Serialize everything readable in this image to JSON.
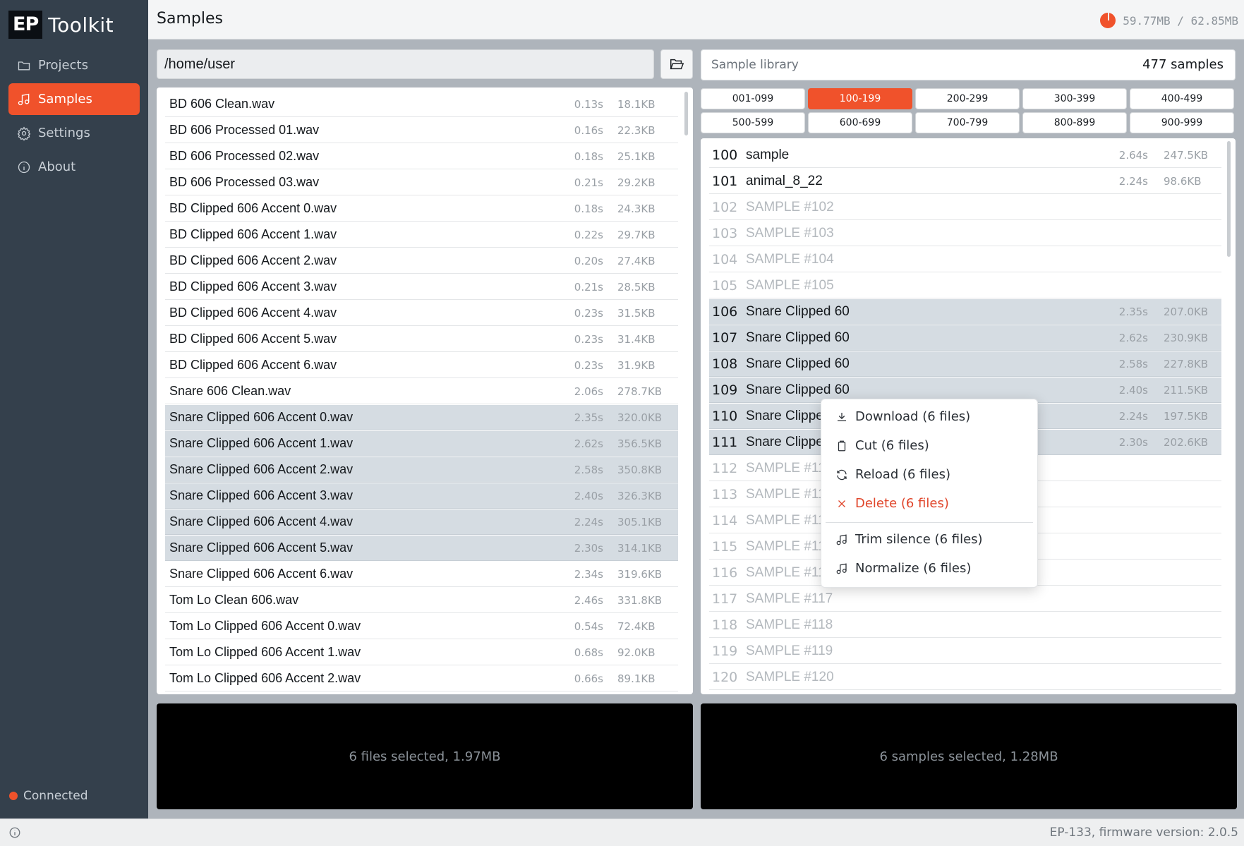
{
  "app": {
    "brand_box": "EP",
    "brand_text": "Toolkit",
    "page_title": "Samples",
    "memory": "59.77MB / 62.85MB",
    "connection_status": "Connected",
    "firmware": "EP-133, firmware version: 2.0.5",
    "accent_color": "#f0522b"
  },
  "sidebar": {
    "items": [
      {
        "label": "Projects",
        "icon": "folder-icon"
      },
      {
        "label": "Samples",
        "icon": "music-note-icon",
        "active": true
      },
      {
        "label": "Settings",
        "icon": "gear-icon"
      },
      {
        "label": "About",
        "icon": "info-icon"
      }
    ]
  },
  "browser": {
    "path": "/home/user",
    "files": [
      {
        "name": "BD 606 Clean.wav",
        "duration": "0.13s",
        "size": "18.1KB"
      },
      {
        "name": "BD 606 Processed 01.wav",
        "duration": "0.16s",
        "size": "22.3KB"
      },
      {
        "name": "BD 606 Processed 02.wav",
        "duration": "0.18s",
        "size": "25.1KB"
      },
      {
        "name": "BD 606 Processed 03.wav",
        "duration": "0.21s",
        "size": "29.2KB"
      },
      {
        "name": "BD Clipped 606 Accent 0.wav",
        "duration": "0.18s",
        "size": "24.3KB"
      },
      {
        "name": "BD Clipped 606 Accent 1.wav",
        "duration": "0.22s",
        "size": "29.7KB"
      },
      {
        "name": "BD Clipped 606 Accent 2.wav",
        "duration": "0.20s",
        "size": "27.4KB"
      },
      {
        "name": "BD Clipped 606 Accent 3.wav",
        "duration": "0.21s",
        "size": "28.5KB"
      },
      {
        "name": "BD Clipped 606 Accent 4.wav",
        "duration": "0.23s",
        "size": "31.5KB"
      },
      {
        "name": "BD Clipped 606 Accent 5.wav",
        "duration": "0.23s",
        "size": "31.4KB"
      },
      {
        "name": "BD Clipped 606 Accent 6.wav",
        "duration": "0.23s",
        "size": "31.9KB"
      },
      {
        "name": "Snare 606 Clean.wav",
        "duration": "2.06s",
        "size": "278.7KB"
      },
      {
        "name": "Snare Clipped 606 Accent 0.wav",
        "duration": "2.35s",
        "size": "320.0KB",
        "selected": true
      },
      {
        "name": "Snare Clipped 606 Accent 1.wav",
        "duration": "2.62s",
        "size": "356.5KB",
        "selected": true
      },
      {
        "name": "Snare Clipped 606 Accent 2.wav",
        "duration": "2.58s",
        "size": "350.8KB",
        "selected": true
      },
      {
        "name": "Snare Clipped 606 Accent 3.wav",
        "duration": "2.40s",
        "size": "326.3KB",
        "selected": true
      },
      {
        "name": "Snare Clipped 606 Accent 4.wav",
        "duration": "2.24s",
        "size": "305.1KB",
        "selected": true
      },
      {
        "name": "Snare Clipped 606 Accent 5.wav",
        "duration": "2.30s",
        "size": "314.1KB",
        "selected": true
      },
      {
        "name": "Snare Clipped 606 Accent 6.wav",
        "duration": "2.34s",
        "size": "319.6KB"
      },
      {
        "name": "Tom Lo Clean 606.wav",
        "duration": "2.46s",
        "size": "331.8KB"
      },
      {
        "name": "Tom Lo Clipped 606 Accent 0.wav",
        "duration": "0.54s",
        "size": "72.4KB"
      },
      {
        "name": "Tom Lo Clipped 606 Accent 1.wav",
        "duration": "0.68s",
        "size": "92.0KB"
      },
      {
        "name": "Tom Lo Clipped 606 Accent 2.wav",
        "duration": "0.66s",
        "size": "89.1KB"
      }
    ],
    "selection_summary": "6 files selected, 1.97MB"
  },
  "library": {
    "title": "Sample library",
    "count": "477 samples",
    "ranges": [
      "001-099",
      "100-199",
      "200-299",
      "300-399",
      "400-499",
      "500-599",
      "600-699",
      "700-799",
      "800-899",
      "900-999"
    ],
    "active_range": "100-199",
    "samples": [
      {
        "num": "100",
        "name": "sample",
        "duration": "2.64s",
        "size": "247.5KB"
      },
      {
        "num": "101",
        "name": "animal_8_22",
        "duration": "2.24s",
        "size": "98.6KB"
      },
      {
        "num": "102",
        "name": "SAMPLE #102",
        "empty": true
      },
      {
        "num": "103",
        "name": "SAMPLE #103",
        "empty": true
      },
      {
        "num": "104",
        "name": "SAMPLE #104",
        "empty": true
      },
      {
        "num": "105",
        "name": "SAMPLE #105",
        "empty": true
      },
      {
        "num": "106",
        "name": "Snare Clipped 60",
        "duration": "2.35s",
        "size": "207.0KB",
        "selected": true
      },
      {
        "num": "107",
        "name": "Snare Clipped 60",
        "duration": "2.62s",
        "size": "230.9KB",
        "selected": true
      },
      {
        "num": "108",
        "name": "Snare Clipped 60",
        "duration": "2.58s",
        "size": "227.8KB",
        "selected": true
      },
      {
        "num": "109",
        "name": "Snare Clipped 60",
        "duration": "2.40s",
        "size": "211.5KB",
        "selected": true
      },
      {
        "num": "110",
        "name": "Snare Clippe",
        "duration": "2.24s",
        "size": "197.5KB",
        "selected": true
      },
      {
        "num": "111",
        "name": "Snare Clippe",
        "duration": "2.30s",
        "size": "202.6KB",
        "selected": true
      },
      {
        "num": "112",
        "name": "SAMPLE #112",
        "empty": true
      },
      {
        "num": "113",
        "name": "SAMPLE #113",
        "empty": true
      },
      {
        "num": "114",
        "name": "SAMPLE #114",
        "empty": true
      },
      {
        "num": "115",
        "name": "SAMPLE #115",
        "empty": true
      },
      {
        "num": "116",
        "name": "SAMPLE #116",
        "empty": true
      },
      {
        "num": "117",
        "name": "SAMPLE #117",
        "empty": true
      },
      {
        "num": "118",
        "name": "SAMPLE #118",
        "empty": true
      },
      {
        "num": "119",
        "name": "SAMPLE #119",
        "empty": true
      },
      {
        "num": "120",
        "name": "SAMPLE #120",
        "empty": true
      }
    ],
    "selection_summary": "6 samples selected, 1.28MB"
  },
  "context_menu": {
    "items": [
      {
        "label": "Download (6 files)",
        "icon": "download-icon"
      },
      {
        "label": "Cut (6 files)",
        "icon": "clipboard-icon"
      },
      {
        "label": "Reload (6 files)",
        "icon": "refresh-icon"
      },
      {
        "label": "Delete (6 files)",
        "icon": "close-icon",
        "danger": true
      },
      {
        "label": "Trim silence (6 files)",
        "icon": "music-note-icon"
      },
      {
        "label": "Normalize (6 files)",
        "icon": "music-note-icon"
      }
    ]
  }
}
